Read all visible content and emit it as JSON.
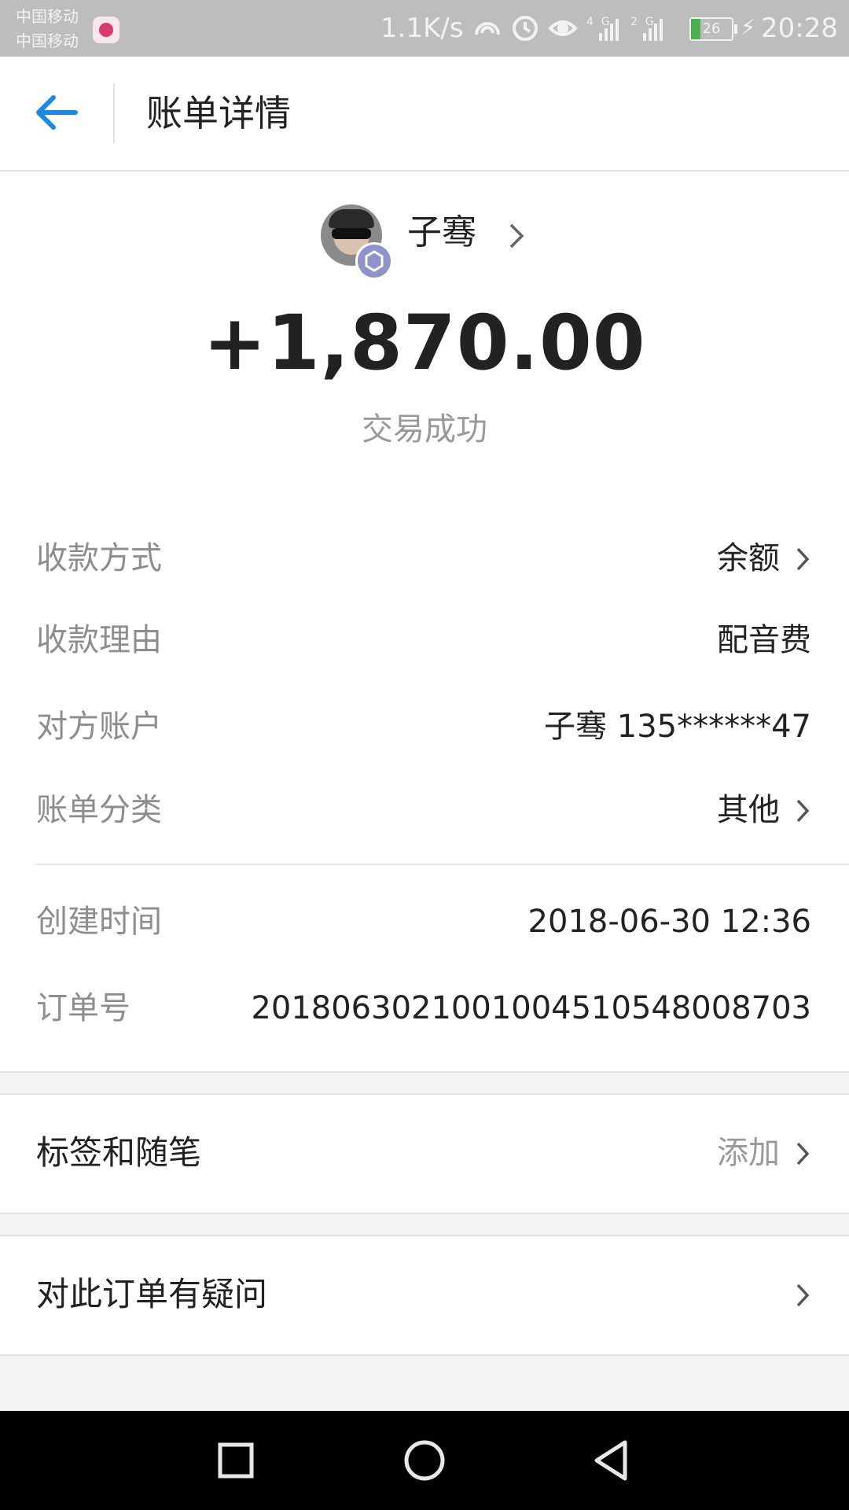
{
  "status_bar": {
    "carrier1": "中国移动",
    "carrier2": "中国移动",
    "speed": "1.1K/s",
    "icons": [
      "nfc-icon",
      "alarm-icon",
      "eye-icon",
      "signal-4g-icon",
      "signal-2g-icon"
    ],
    "net_4g": "4G",
    "net_2g": "2G",
    "battery": "26",
    "time": "20:28"
  },
  "header": {
    "title": "账单详情"
  },
  "payer": {
    "name": "子骞"
  },
  "transaction": {
    "amount": "+1,870.00",
    "status": "交易成功"
  },
  "details": [
    {
      "label": "收款方式",
      "value": "余额",
      "has_chevron": true
    },
    {
      "label": "收款理由",
      "value": "配音费",
      "has_chevron": false
    },
    {
      "label": "对方账户",
      "value": "子骞 135******47",
      "has_chevron": false
    },
    {
      "label": "账单分类",
      "value": "其他",
      "has_chevron": true
    },
    {
      "label": "创建时间",
      "value": "2018-06-30 12:36",
      "has_chevron": false
    },
    {
      "label": "订单号",
      "value": "2018063021001004510548008703",
      "has_chevron": false
    }
  ],
  "tags": {
    "label": "标签和随笔",
    "value": "添加"
  },
  "dispute": {
    "label": "对此订单有疑问"
  },
  "colors": {
    "accent": "#1e88e5",
    "background": "#f4f4f4",
    "status_bar": "#bdbdbd"
  }
}
